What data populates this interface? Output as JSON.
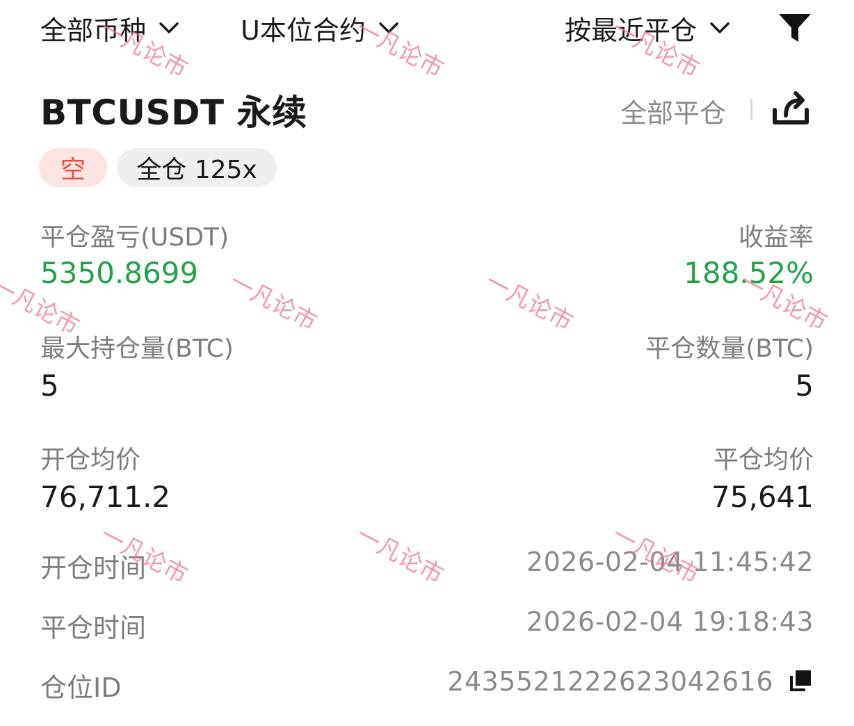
{
  "filters": {
    "coin": "全部币种",
    "contract": "U本位合约",
    "sort": "按最近平仓"
  },
  "position": {
    "symbol": "BTCUSDT 永续",
    "close_all": "全部平仓",
    "side_tag": "空",
    "margin_tag": "全仓 125x"
  },
  "stats": {
    "pnl_label": "平仓盈亏(USDT)",
    "pnl_value": "5350.8699",
    "roi_label": "收益率",
    "roi_value": "188.52%",
    "max_pos_label": "最大持仓量(BTC)",
    "max_pos_value": "5",
    "closed_qty_label": "平仓数量(BTC)",
    "closed_qty_value": "5",
    "open_price_label": "开仓均价",
    "open_price_value": "76,711.2",
    "close_price_label": "平仓均价",
    "close_price_value": "75,641"
  },
  "meta": {
    "open_time_label": "开仓时间",
    "open_time_value": "2026-02-04 11:45:42",
    "close_time_label": "平仓时间",
    "close_time_value": "2026-02-04 19:18:43",
    "position_id_label": "仓位ID",
    "position_id_value": "2435521222623042616"
  },
  "watermark": "一凡论市",
  "colors": {
    "profit": "#1fa34a",
    "short": "#e0553e",
    "short_bg": "#fbe4e1"
  },
  "icons": [
    "chevron-down-icon",
    "filter-icon",
    "share-icon",
    "copy-icon"
  ]
}
